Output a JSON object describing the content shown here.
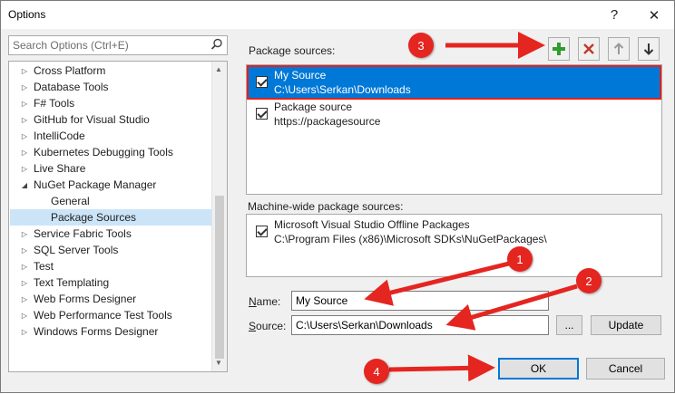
{
  "window": {
    "title": "Options",
    "help_glyph": "?",
    "close_glyph": "✕"
  },
  "search": {
    "placeholder": "Search Options (Ctrl+E)"
  },
  "tree": [
    {
      "label": "Cross Platform",
      "expanded": false,
      "child": false
    },
    {
      "label": "Database Tools",
      "expanded": false,
      "child": false
    },
    {
      "label": "F# Tools",
      "expanded": false,
      "child": false
    },
    {
      "label": "GitHub for Visual Studio",
      "expanded": false,
      "child": false
    },
    {
      "label": "IntelliCode",
      "expanded": false,
      "child": false
    },
    {
      "label": "Kubernetes Debugging Tools",
      "expanded": false,
      "child": false
    },
    {
      "label": "Live Share",
      "expanded": false,
      "child": false
    },
    {
      "label": "NuGet Package Manager",
      "expanded": true,
      "child": false
    },
    {
      "label": "General",
      "expanded": false,
      "child": true
    },
    {
      "label": "Package Sources",
      "expanded": false,
      "child": true,
      "selected": true
    },
    {
      "label": "Service Fabric Tools",
      "expanded": false,
      "child": false
    },
    {
      "label": "SQL Server Tools",
      "expanded": false,
      "child": false
    },
    {
      "label": "Test",
      "expanded": false,
      "child": false
    },
    {
      "label": "Text Templating",
      "expanded": false,
      "child": false
    },
    {
      "label": "Web Forms Designer",
      "expanded": false,
      "child": false
    },
    {
      "label": "Web Performance Test Tools",
      "expanded": false,
      "child": false
    },
    {
      "label": "Windows Forms Designer",
      "expanded": false,
      "child": false
    }
  ],
  "package_sources": {
    "label": "Package sources:",
    "items": [
      {
        "name": "My Source",
        "path": "C:\\Users\\Serkan\\Downloads",
        "checked": true,
        "selected": true
      },
      {
        "name": "Package source",
        "path": "https://packagesource",
        "checked": true,
        "selected": false
      }
    ]
  },
  "machine_sources": {
    "label": "Machine-wide package sources:",
    "items": [
      {
        "name": "Microsoft Visual Studio Offline Packages",
        "path": "C:\\Program Files (x86)\\Microsoft SDKs\\NuGetPackages\\",
        "checked": true
      }
    ]
  },
  "form": {
    "name_label_u": "N",
    "name_label_rest": "ame:",
    "name_value": "My Source",
    "source_label_u": "S",
    "source_label_rest": "ource:",
    "source_value": "C:\\Users\\Serkan\\Downloads",
    "browse_label": "...",
    "update_label": "Update"
  },
  "buttons": {
    "ok": "OK",
    "cancel": "Cancel"
  },
  "annotations": [
    "1",
    "2",
    "3",
    "4"
  ],
  "colors": {
    "accent": "#0078d7",
    "annotation": "#e52520",
    "add_icon": "#2e9e2e",
    "remove_icon": "#c0392b"
  }
}
